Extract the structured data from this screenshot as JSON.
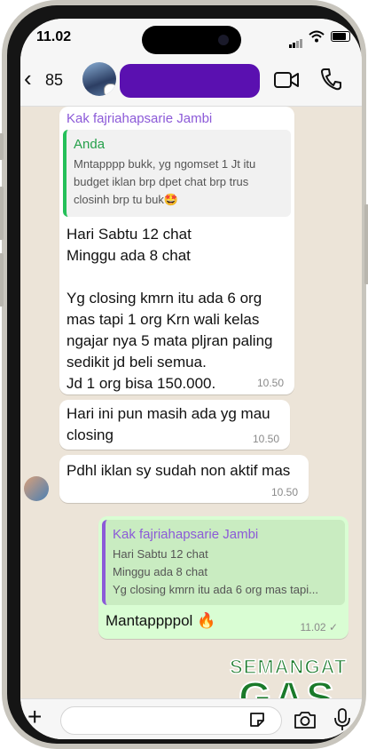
{
  "status_bar": {
    "time": "11.02"
  },
  "header": {
    "back_label": "85"
  },
  "messages": [
    {
      "sender": "Kak fajriahapsarie Jambi",
      "quote_name": "Anda",
      "quote_text": "Mntapppp bukk, yg ngomset 1 Jt itu\nbudget iklan brp dpet chat brp trus\nclosinh brp tu buk🤩",
      "text": "Hari Sabtu 12 chat\nMinggu ada 8 chat\n\nYg closing kmrn itu ada 6 org\nmas tapi 1 org Krn wali kelas\nngajar nya 5 mata pljran paling\nsedikit jd beli semua.\nJd 1 org bisa 150.000.",
      "time": "10.50"
    },
    {
      "text": "Hari ini pun masih ada yg mau\nclosing",
      "time": "10.50"
    },
    {
      "text": "Pdhl iklan sy sudah non aktif mas",
      "time": "10.50"
    },
    {
      "quote_name": "Kak fajriahapsarie Jambi",
      "quote_text": "Hari Sabtu 12 chat\nMinggu ada 8 chat\nYg closing kmrn itu ada 6 org mas tapi...",
      "text": "Mantappppol 🔥",
      "time": "11.02 ✓"
    }
  ],
  "sticker": {
    "line1": "SEMANGAT",
    "line2": "GAS"
  },
  "colors": {
    "outgoing": "#d9fdd3",
    "incoming": "#ffffff",
    "accent": "#25d366",
    "sender_name": "#8c5ad8"
  },
  "icons": [
    "back-icon",
    "video-call-icon",
    "voice-call-icon",
    "plus-icon",
    "sticker-icon",
    "camera-icon",
    "mic-icon"
  ]
}
